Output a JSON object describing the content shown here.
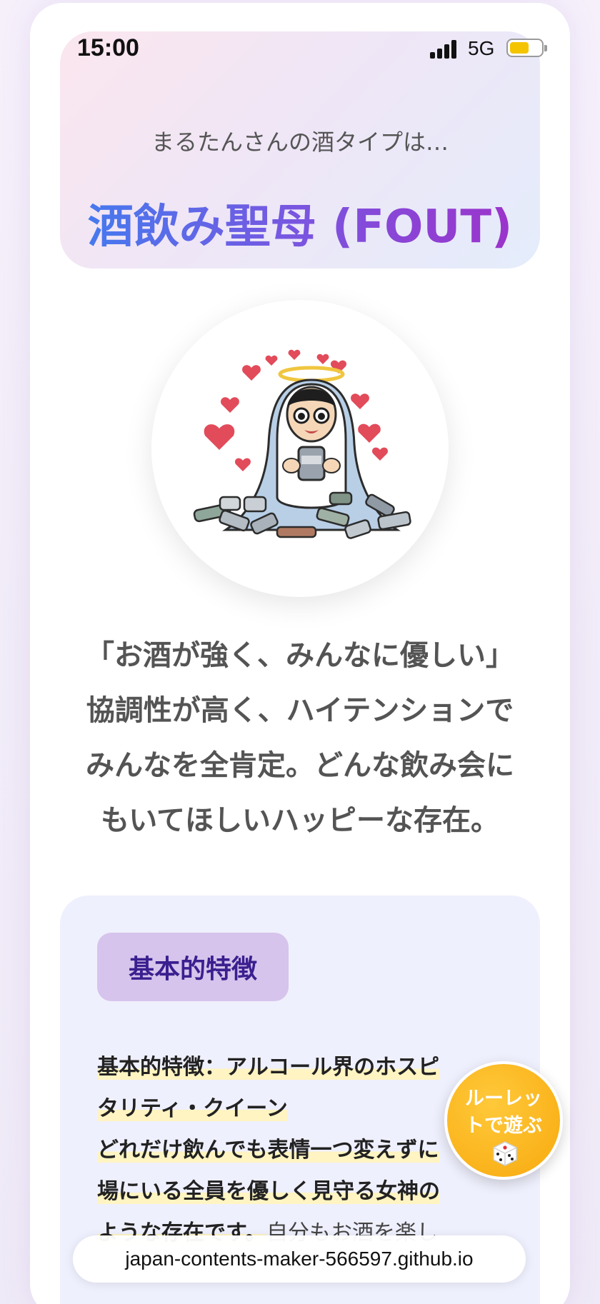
{
  "status_bar": {
    "time": "15:00",
    "network": "5G",
    "battery_level": 0.55
  },
  "header": {
    "subtitle": "まるたんさんの酒タイプは…",
    "title": "酒飲み聖母 (FOUT)"
  },
  "illustration": {
    "icon": "drinking-madonna-illustration"
  },
  "description": [
    "「お酒が強く、みんなに優しい」",
    "協調性が高く、ハイテンションで",
    "みんなを全肯定。どんな飲み会に",
    "もいてほしいハッピーな存在。"
  ],
  "features": {
    "badge": "基本的特徴",
    "lines": [
      "基本的特徴：アルコール界のホスピ",
      "タリティ・クイーン",
      "どれだけ飲んでも表情一つ変えずに",
      "場にいる全員を優しく見守る女神の",
      "ような存在です。",
      "自分もお酒を楽し"
    ]
  },
  "roulette": {
    "label": "ルーレットで遊ぶ",
    "icon": "dice-icon"
  },
  "browser": {
    "url": "japan-contents-maker-566597.github.io"
  }
}
